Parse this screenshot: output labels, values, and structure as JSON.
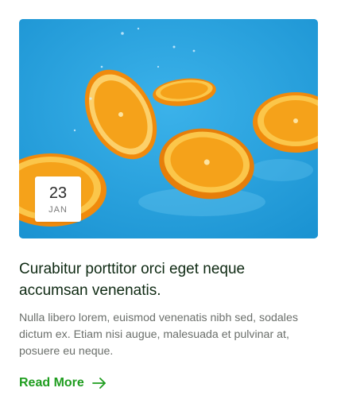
{
  "post": {
    "date": {
      "day": "23",
      "month": "JAN"
    },
    "title": "Curabitur porttitor orci eget neque accumsan venenatis.",
    "excerpt": "Nulla libero lorem, euismod venenatis nibh sed, sodales dictum ex. Etiam nisi augue, malesuada et pulvinar at, posuere eu neque.",
    "read_more_label": "Read More",
    "image_icon": "orange-slices-image",
    "arrow_icon": "arrow-right-icon"
  },
  "colors": {
    "accent": "#1f9d1f",
    "title": "#0f2a13",
    "body_text": "#6b6f6b",
    "image_background": "#2aa3df"
  }
}
